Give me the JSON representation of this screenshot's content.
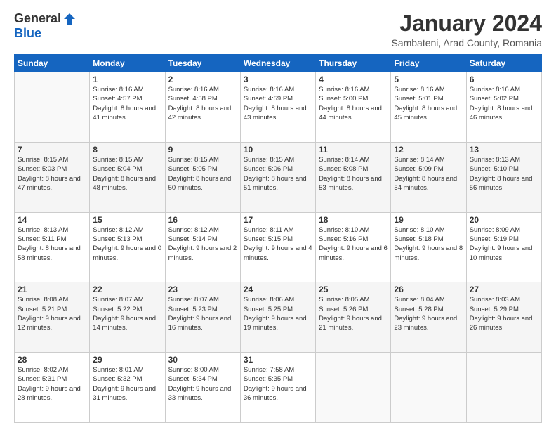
{
  "logo": {
    "general": "General",
    "blue": "Blue"
  },
  "title": "January 2024",
  "location": "Sambateni, Arad County, Romania",
  "days_of_week": [
    "Sunday",
    "Monday",
    "Tuesday",
    "Wednesday",
    "Thursday",
    "Friday",
    "Saturday"
  ],
  "weeks": [
    [
      {
        "day": "",
        "sunrise": "",
        "sunset": "",
        "daylight": ""
      },
      {
        "day": "1",
        "sunrise": "Sunrise: 8:16 AM",
        "sunset": "Sunset: 4:57 PM",
        "daylight": "Daylight: 8 hours and 41 minutes."
      },
      {
        "day": "2",
        "sunrise": "Sunrise: 8:16 AM",
        "sunset": "Sunset: 4:58 PM",
        "daylight": "Daylight: 8 hours and 42 minutes."
      },
      {
        "day": "3",
        "sunrise": "Sunrise: 8:16 AM",
        "sunset": "Sunset: 4:59 PM",
        "daylight": "Daylight: 8 hours and 43 minutes."
      },
      {
        "day": "4",
        "sunrise": "Sunrise: 8:16 AM",
        "sunset": "Sunset: 5:00 PM",
        "daylight": "Daylight: 8 hours and 44 minutes."
      },
      {
        "day": "5",
        "sunrise": "Sunrise: 8:16 AM",
        "sunset": "Sunset: 5:01 PM",
        "daylight": "Daylight: 8 hours and 45 minutes."
      },
      {
        "day": "6",
        "sunrise": "Sunrise: 8:16 AM",
        "sunset": "Sunset: 5:02 PM",
        "daylight": "Daylight: 8 hours and 46 minutes."
      }
    ],
    [
      {
        "day": "7",
        "sunrise": "Sunrise: 8:15 AM",
        "sunset": "Sunset: 5:03 PM",
        "daylight": "Daylight: 8 hours and 47 minutes."
      },
      {
        "day": "8",
        "sunrise": "Sunrise: 8:15 AM",
        "sunset": "Sunset: 5:04 PM",
        "daylight": "Daylight: 8 hours and 48 minutes."
      },
      {
        "day": "9",
        "sunrise": "Sunrise: 8:15 AM",
        "sunset": "Sunset: 5:05 PM",
        "daylight": "Daylight: 8 hours and 50 minutes."
      },
      {
        "day": "10",
        "sunrise": "Sunrise: 8:15 AM",
        "sunset": "Sunset: 5:06 PM",
        "daylight": "Daylight: 8 hours and 51 minutes."
      },
      {
        "day": "11",
        "sunrise": "Sunrise: 8:14 AM",
        "sunset": "Sunset: 5:08 PM",
        "daylight": "Daylight: 8 hours and 53 minutes."
      },
      {
        "day": "12",
        "sunrise": "Sunrise: 8:14 AM",
        "sunset": "Sunset: 5:09 PM",
        "daylight": "Daylight: 8 hours and 54 minutes."
      },
      {
        "day": "13",
        "sunrise": "Sunrise: 8:13 AM",
        "sunset": "Sunset: 5:10 PM",
        "daylight": "Daylight: 8 hours and 56 minutes."
      }
    ],
    [
      {
        "day": "14",
        "sunrise": "Sunrise: 8:13 AM",
        "sunset": "Sunset: 5:11 PM",
        "daylight": "Daylight: 8 hours and 58 minutes."
      },
      {
        "day": "15",
        "sunrise": "Sunrise: 8:12 AM",
        "sunset": "Sunset: 5:13 PM",
        "daylight": "Daylight: 9 hours and 0 minutes."
      },
      {
        "day": "16",
        "sunrise": "Sunrise: 8:12 AM",
        "sunset": "Sunset: 5:14 PM",
        "daylight": "Daylight: 9 hours and 2 minutes."
      },
      {
        "day": "17",
        "sunrise": "Sunrise: 8:11 AM",
        "sunset": "Sunset: 5:15 PM",
        "daylight": "Daylight: 9 hours and 4 minutes."
      },
      {
        "day": "18",
        "sunrise": "Sunrise: 8:10 AM",
        "sunset": "Sunset: 5:16 PM",
        "daylight": "Daylight: 9 hours and 6 minutes."
      },
      {
        "day": "19",
        "sunrise": "Sunrise: 8:10 AM",
        "sunset": "Sunset: 5:18 PM",
        "daylight": "Daylight: 9 hours and 8 minutes."
      },
      {
        "day": "20",
        "sunrise": "Sunrise: 8:09 AM",
        "sunset": "Sunset: 5:19 PM",
        "daylight": "Daylight: 9 hours and 10 minutes."
      }
    ],
    [
      {
        "day": "21",
        "sunrise": "Sunrise: 8:08 AM",
        "sunset": "Sunset: 5:21 PM",
        "daylight": "Daylight: 9 hours and 12 minutes."
      },
      {
        "day": "22",
        "sunrise": "Sunrise: 8:07 AM",
        "sunset": "Sunset: 5:22 PM",
        "daylight": "Daylight: 9 hours and 14 minutes."
      },
      {
        "day": "23",
        "sunrise": "Sunrise: 8:07 AM",
        "sunset": "Sunset: 5:23 PM",
        "daylight": "Daylight: 9 hours and 16 minutes."
      },
      {
        "day": "24",
        "sunrise": "Sunrise: 8:06 AM",
        "sunset": "Sunset: 5:25 PM",
        "daylight": "Daylight: 9 hours and 19 minutes."
      },
      {
        "day": "25",
        "sunrise": "Sunrise: 8:05 AM",
        "sunset": "Sunset: 5:26 PM",
        "daylight": "Daylight: 9 hours and 21 minutes."
      },
      {
        "day": "26",
        "sunrise": "Sunrise: 8:04 AM",
        "sunset": "Sunset: 5:28 PM",
        "daylight": "Daylight: 9 hours and 23 minutes."
      },
      {
        "day": "27",
        "sunrise": "Sunrise: 8:03 AM",
        "sunset": "Sunset: 5:29 PM",
        "daylight": "Daylight: 9 hours and 26 minutes."
      }
    ],
    [
      {
        "day": "28",
        "sunrise": "Sunrise: 8:02 AM",
        "sunset": "Sunset: 5:31 PM",
        "daylight": "Daylight: 9 hours and 28 minutes."
      },
      {
        "day": "29",
        "sunrise": "Sunrise: 8:01 AM",
        "sunset": "Sunset: 5:32 PM",
        "daylight": "Daylight: 9 hours and 31 minutes."
      },
      {
        "day": "30",
        "sunrise": "Sunrise: 8:00 AM",
        "sunset": "Sunset: 5:34 PM",
        "daylight": "Daylight: 9 hours and 33 minutes."
      },
      {
        "day": "31",
        "sunrise": "Sunrise: 7:58 AM",
        "sunset": "Sunset: 5:35 PM",
        "daylight": "Daylight: 9 hours and 36 minutes."
      },
      {
        "day": "",
        "sunrise": "",
        "sunset": "",
        "daylight": ""
      },
      {
        "day": "",
        "sunrise": "",
        "sunset": "",
        "daylight": ""
      },
      {
        "day": "",
        "sunrise": "",
        "sunset": "",
        "daylight": ""
      }
    ]
  ]
}
